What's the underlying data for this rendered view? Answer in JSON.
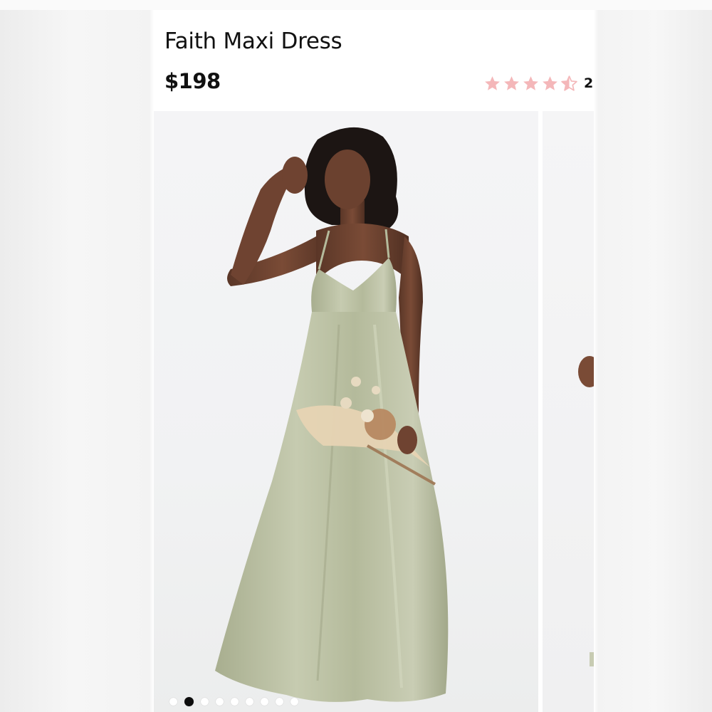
{
  "product": {
    "title": "Faith Maxi Dress",
    "price": "$198",
    "rating": {
      "value": 4.5,
      "max": 5,
      "count_text": "2",
      "star_color": "#f4b7b9"
    }
  },
  "gallery": {
    "slide_count": 9,
    "active_index": 1,
    "main_image": "model-in-sage-satin-maxi-dress-holding-dried-bouquet",
    "dress_color": "#b9bfa2"
  }
}
